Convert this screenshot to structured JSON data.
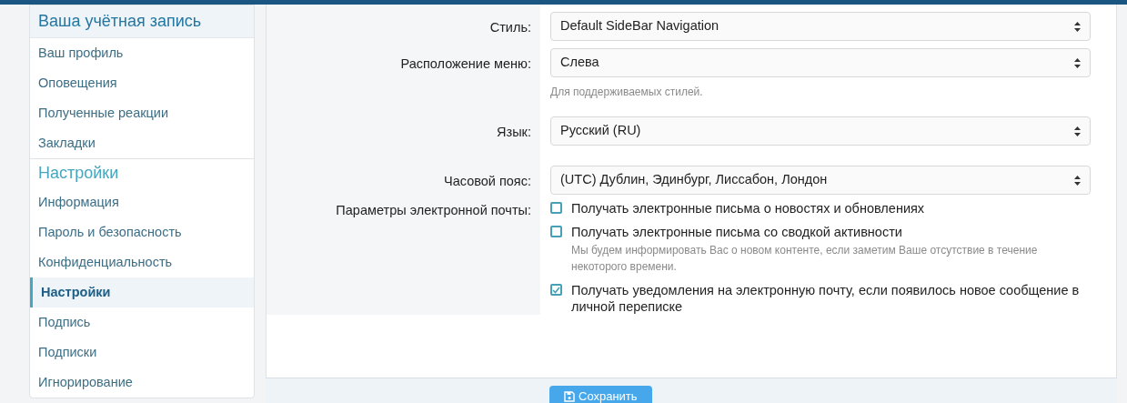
{
  "sidebar": {
    "sections": [
      {
        "title": "Ваша учётная запись",
        "items": [
          {
            "label": "Ваш профиль",
            "selected": false
          },
          {
            "label": "Оповещения",
            "selected": false
          },
          {
            "label": "Полученные реакции",
            "selected": false
          },
          {
            "label": "Закладки",
            "selected": false
          }
        ]
      },
      {
        "title": "Настройки",
        "items": [
          {
            "label": "Информация",
            "selected": false
          },
          {
            "label": "Пароль и безопасность",
            "selected": false
          },
          {
            "label": "Конфиденциальность",
            "selected": false
          },
          {
            "label": "Настройки",
            "selected": true
          },
          {
            "label": "Подпись",
            "selected": false
          },
          {
            "label": "Подписки",
            "selected": false
          },
          {
            "label": "Игнорирование",
            "selected": false
          }
        ]
      }
    ]
  },
  "form": {
    "rows": [
      {
        "kind": "select",
        "label": "Стиль:",
        "value": "Default SideBar Navigation"
      },
      {
        "kind": "select",
        "label": "Расположение меню:",
        "value": "Слева",
        "hint": "Для поддерживаемых стилей."
      },
      {
        "kind": "select",
        "label": "Язык:",
        "value": "Русский (RU)"
      },
      {
        "kind": "select",
        "label": "Часовой пояс:",
        "value": "(UTC) Дублин, Эдинбург, Лиссабон, Лондон"
      },
      {
        "kind": "checkboxes",
        "label": "Параметры электронной почты:",
        "options": [
          {
            "label": "Получать электронные письма о новостях и обновлениях",
            "checked": false
          },
          {
            "label": "Получать электронные письма со сводкой активности",
            "checked": false,
            "hint": "Мы будем информировать Вас о новом контенте, если заметим Ваше отсутствие в течение некоторого времени."
          },
          {
            "label": "Получать уведомления на электронную почту, если появилось новое сообщение в личной переписке",
            "checked": true
          }
        ]
      }
    ]
  },
  "save_button": "Сохранить"
}
